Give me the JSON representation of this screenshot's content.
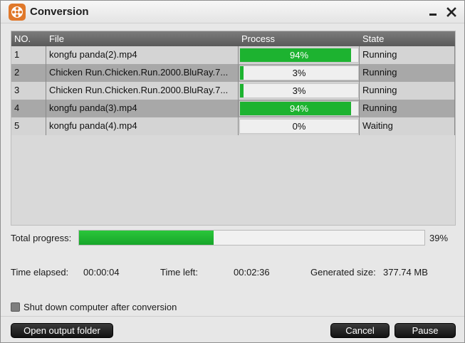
{
  "window": {
    "title": "Conversion"
  },
  "table": {
    "headers": {
      "no": "NO.",
      "file": "File",
      "process": "Process",
      "state": "State"
    },
    "rows": [
      {
        "no": "1",
        "file": "kongfu panda(2).mp4",
        "progress": 94,
        "progress_label": "94%",
        "state": "Running"
      },
      {
        "no": "2",
        "file": "Chicken Run.Chicken.Run.2000.BluRay.7...",
        "progress": 3,
        "progress_label": "3%",
        "state": "Running"
      },
      {
        "no": "3",
        "file": "Chicken Run.Chicken.Run.2000.BluRay.7...",
        "progress": 3,
        "progress_label": "3%",
        "state": "Running"
      },
      {
        "no": "4",
        "file": "kongfu panda(3).mp4",
        "progress": 94,
        "progress_label": "94%",
        "state": "Running"
      },
      {
        "no": "5",
        "file": "kongfu panda(4).mp4",
        "progress": 0,
        "progress_label": "0%",
        "state": "Waiting"
      }
    ]
  },
  "total": {
    "label": "Total progress:",
    "progress": 39,
    "progress_label": "39%"
  },
  "info": {
    "elapsed_label": "Time elapsed:",
    "elapsed_value": "00:00:04",
    "left_label": "Time left:",
    "left_value": "00:02:36",
    "size_label": "Generated size:",
    "size_value": "377.74 MB"
  },
  "shutdown": {
    "label": "Shut down computer after conversion",
    "checked": false
  },
  "buttons": {
    "open_folder": "Open output folder",
    "cancel": "Cancel",
    "pause": "Pause"
  },
  "colors": {
    "progress_fill": "#1db330",
    "header_bg": "#6a6a6a",
    "accent": "#e0782a"
  }
}
